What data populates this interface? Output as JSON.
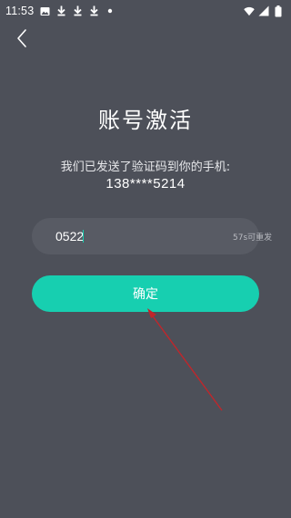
{
  "status_bar": {
    "time": "11:53",
    "left_icons": [
      "image-icon",
      "download-icon",
      "download-icon",
      "download-icon",
      "dot-icon"
    ],
    "right_icons": [
      "wifi-icon",
      "signal-icon",
      "battery-icon"
    ]
  },
  "header": {
    "back_icon": "chevron-left-icon"
  },
  "main": {
    "title": "账号激活",
    "subtitle": "我们已发送了验证码到你的手机:",
    "phone_number": "138****5214",
    "code_input": {
      "value": "0522",
      "placeholder": ""
    },
    "resend_label": "57s可重发",
    "confirm_label": "确定"
  },
  "colors": {
    "background": "#4d5059",
    "input_background": "#585b64",
    "accent": "#17cfb0",
    "annotation_arrow": "#c0262b"
  }
}
